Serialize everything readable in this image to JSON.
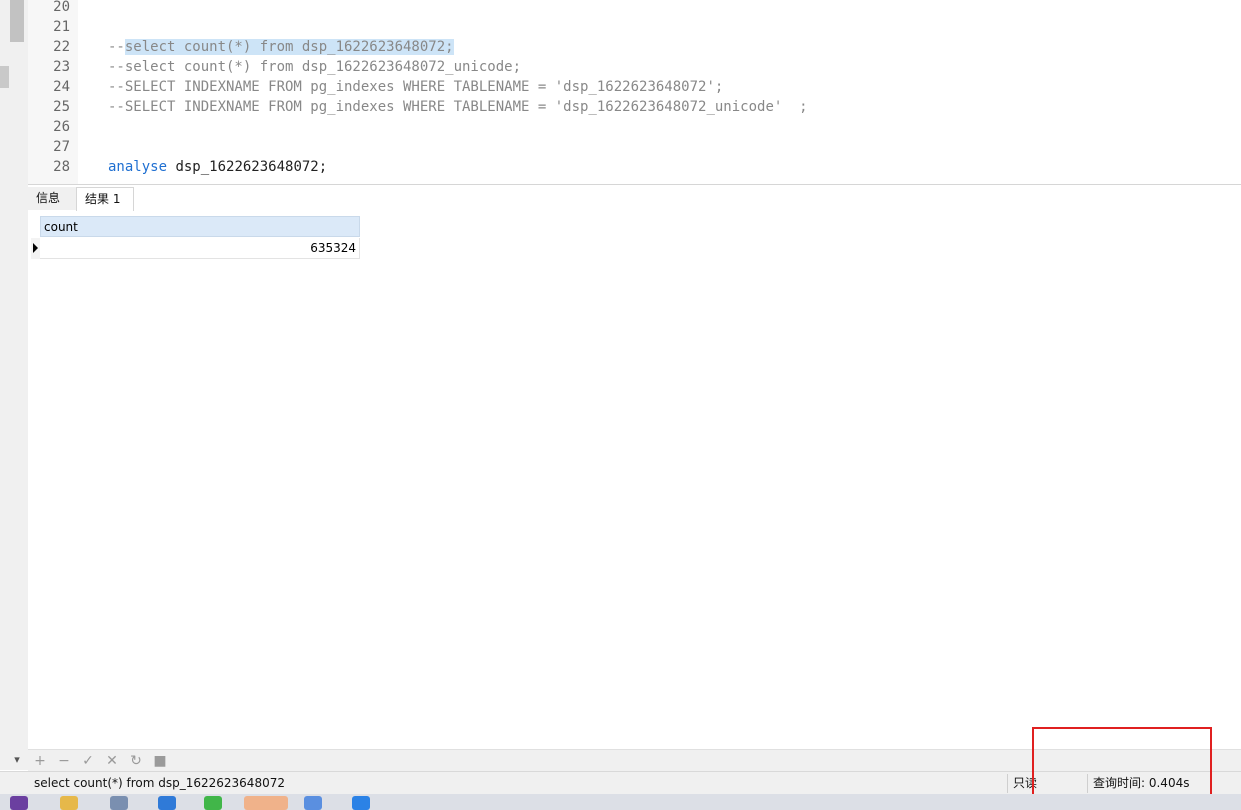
{
  "editor": {
    "lines": [
      {
        "num": "20",
        "parts": []
      },
      {
        "num": "21",
        "parts": []
      },
      {
        "num": "22",
        "parts": [
          {
            "t": "--",
            "c": "comment"
          },
          {
            "t": "select count(*) from dsp_1622623648072;",
            "c": "selected"
          }
        ]
      },
      {
        "num": "23",
        "parts": [
          {
            "t": "--select count(*) from dsp_1622623648072_unicode;",
            "c": "comment"
          }
        ]
      },
      {
        "num": "24",
        "parts": [
          {
            "t": "--SELECT INDEXNAME FROM pg_indexes WHERE TABLENAME = 'dsp_1622623648072';",
            "c": "comment"
          }
        ]
      },
      {
        "num": "25",
        "parts": [
          {
            "t": "--SELECT INDEXNAME FROM pg_indexes WHERE TABLENAME = 'dsp_1622623648072_unicode'  ;",
            "c": "comment"
          }
        ]
      },
      {
        "num": "26",
        "parts": []
      },
      {
        "num": "27",
        "parts": []
      },
      {
        "num": "28",
        "parts": [
          {
            "t": "analyse",
            "c": "keyword"
          },
          {
            "t": " dsp_1622623648072;",
            "c": "plain"
          }
        ]
      }
    ]
  },
  "tabs": {
    "info": "信息",
    "result": "结果 1"
  },
  "grid": {
    "columns": [
      "count"
    ],
    "rows": [
      [
        "635324"
      ]
    ]
  },
  "toolbar": {
    "add": "+",
    "remove": "−",
    "apply": "✓",
    "discard": "✕",
    "refresh": "↻",
    "stop": "■"
  },
  "status": {
    "sql": "select count(*) from dsp_1622623648072",
    "readonly": "只读",
    "query_time": "查询时间: 0.404s"
  },
  "colors": {
    "keyword": "#1f6fd1",
    "comment": "#888888",
    "selection": "#cde4f7",
    "header": "#dbe9f8",
    "highlight_box": "#e02020"
  }
}
